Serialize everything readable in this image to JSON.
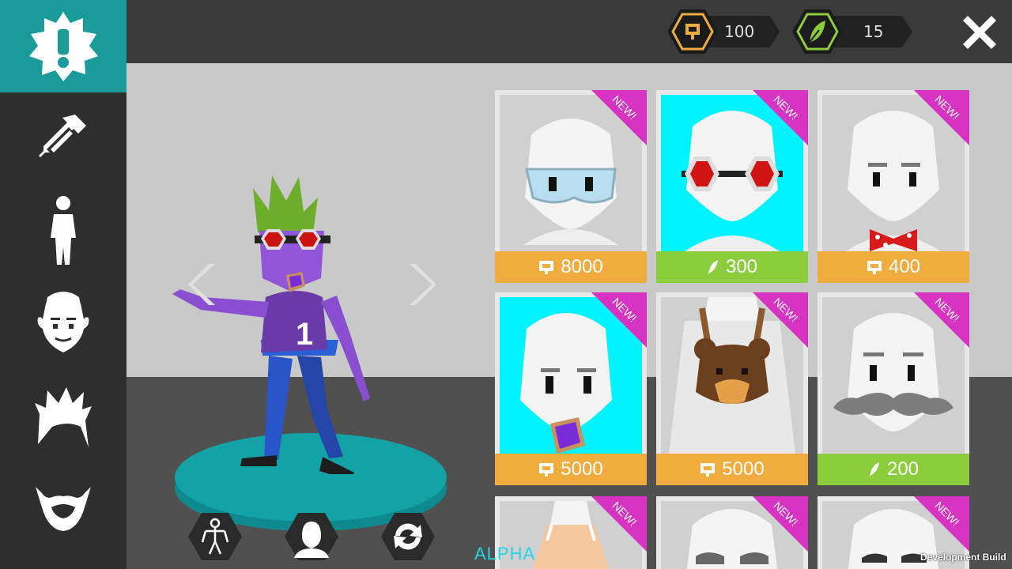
{
  "hud": {
    "tickets": "100",
    "feathers": "15"
  },
  "sidebar": [
    {
      "name": "alert",
      "icon": "alert-badge-icon"
    },
    {
      "name": "color",
      "icon": "eyedropper-icon"
    },
    {
      "name": "body",
      "icon": "body-icon"
    },
    {
      "name": "face",
      "icon": "face-icon"
    },
    {
      "name": "hair",
      "icon": "hair-icon"
    },
    {
      "name": "beard",
      "icon": "beard-icon"
    }
  ],
  "footer": {
    "alpha": "ALPHA",
    "dev_build": "Development Build"
  },
  "items": [
    {
      "price": "8000",
      "currency": "ticket",
      "badge": "NEW!"
    },
    {
      "price": "300",
      "currency": "feather",
      "badge": "NEW!"
    },
    {
      "price": "400",
      "currency": "ticket",
      "badge": "NEW!"
    },
    {
      "price": "5000",
      "currency": "ticket",
      "badge": "NEW!"
    },
    {
      "price": "5000",
      "currency": "ticket",
      "badge": "NEW!"
    },
    {
      "price": "200",
      "currency": "feather",
      "badge": "NEW!"
    },
    {
      "badge": "NEW!"
    },
    {
      "badge": "NEW!"
    },
    {
      "badge": "NEW!"
    }
  ],
  "colors": {
    "accent": "#1b9a9a",
    "gold": "#f0ac3e",
    "green": "#8ccd3e",
    "badge": "#d633c2",
    "selected": "#00f4ff"
  }
}
